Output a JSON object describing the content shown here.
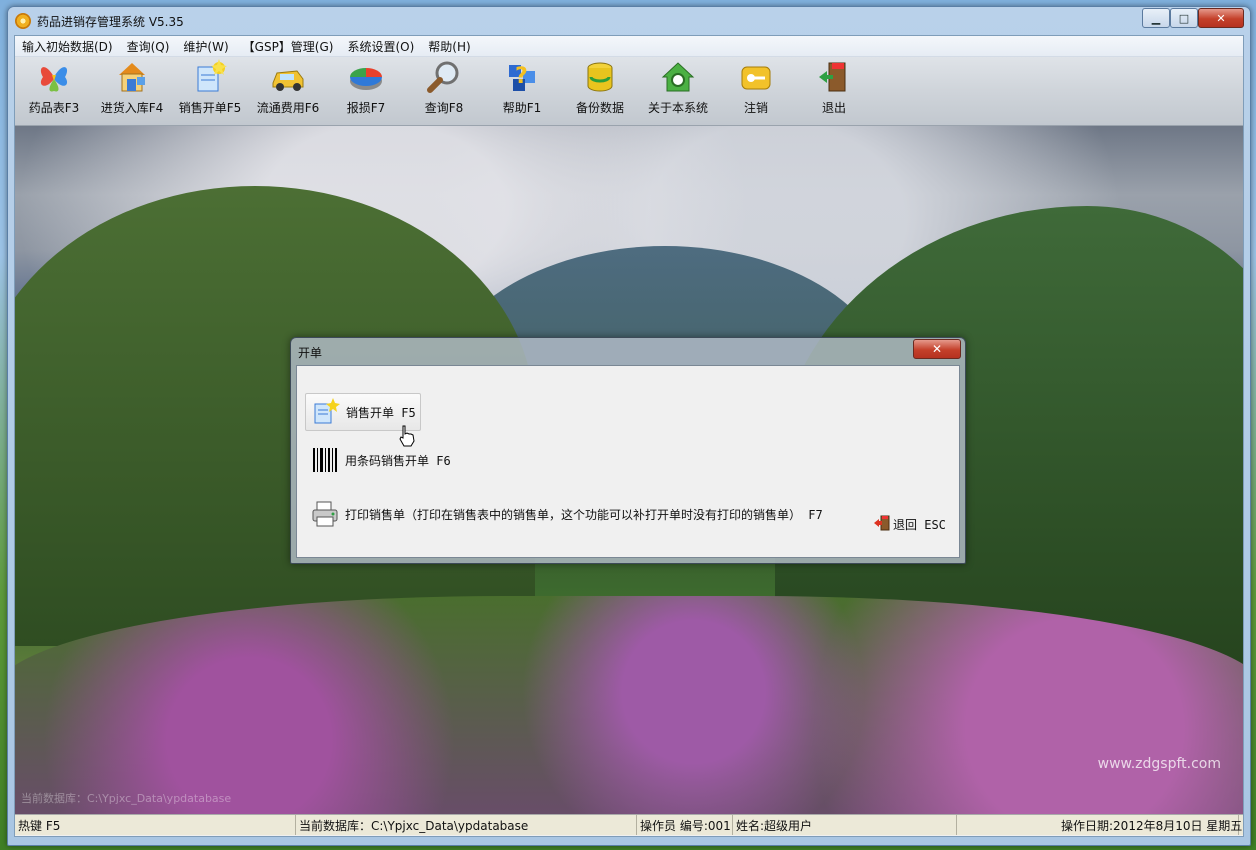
{
  "window": {
    "title": "药品进销存管理系统 V5.35",
    "controls": {
      "minimize": "▁",
      "maximize": "□",
      "close": "✕"
    }
  },
  "menu": [
    "输入初始数据(D)",
    "查询(Q)",
    "维护(W)",
    "【GSP】管理(G)",
    "系统设置(O)",
    "帮助(H)"
  ],
  "toolbar": [
    {
      "label": "药品表F3",
      "icon": "msn-butterfly-icon"
    },
    {
      "label": "进货入库F4",
      "icon": "house-box-icon"
    },
    {
      "label": "销售开单F5",
      "icon": "new-document-icon"
    },
    {
      "label": "流通费用F6",
      "icon": "car-icon"
    },
    {
      "label": "报损F7",
      "icon": "pie-chart-icon"
    },
    {
      "label": "查询F8",
      "icon": "magnifier-icon"
    },
    {
      "label": "帮助F1",
      "icon": "help-question-icon"
    },
    {
      "label": "备份数据",
      "icon": "database-backup-icon"
    },
    {
      "label": "关于本系统",
      "icon": "home-search-icon"
    },
    {
      "label": "注销",
      "icon": "key-icon"
    },
    {
      "label": "退出",
      "icon": "exit-door-icon"
    }
  ],
  "dialog": {
    "title": "开单",
    "close": "✕",
    "options": [
      {
        "label": "销售开单 F5",
        "icon": "new-document-icon"
      },
      {
        "label": "用条码销售开单 F6",
        "icon": "barcode-icon"
      },
      {
        "label": "打印销售单（打印在销售表中的销售单，这个功能可以补打开单时没有打印的销售单） F7",
        "icon": "printer-icon"
      }
    ],
    "exit": {
      "label": "退回 ESC",
      "icon": "exit-door-icon"
    }
  },
  "landscape": {
    "watermark": "www.zdgspft.com",
    "ghost": "当前数据库：C:\\Ypjxc_Data\\ypdatabase"
  },
  "statusbar": {
    "hotkey": "热键 F5",
    "database": "当前数据库：C:\\Ypjxc_Data\\ypdatabase",
    "operator": "操作员 编号:001",
    "name": "姓名:超级用户",
    "date": "操作日期:2012年8月10日 星期五"
  }
}
